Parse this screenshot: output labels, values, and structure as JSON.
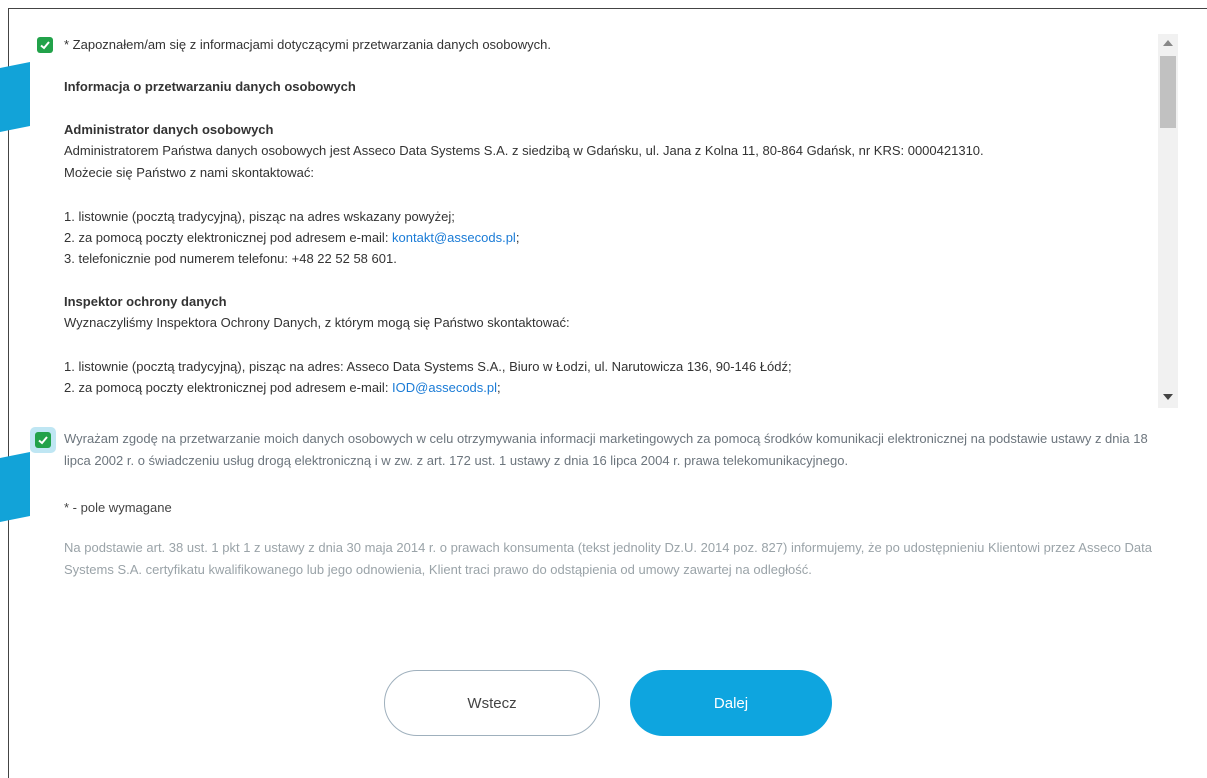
{
  "consent1": {
    "label": "* Zapoznałem/am się z informacjami dotyczącymi przetwarzania danych osobowych.",
    "checked": true
  },
  "info": {
    "heading": "Informacja o przetwarzaniu danych osobowych",
    "admin_heading": "Administrator danych osobowych",
    "admin_text": "Administratorem Państwa danych osobowych jest Asseco Data Systems S.A. z siedzibą w Gdańsku, ul. Jana z Kolna 11, 80-864 Gdańsk, nr KRS: 0000421310.",
    "admin_contact": "Możecie się Państwo z nami skontaktować:",
    "admin_list": [
      "1. listownie (pocztą tradycyjną), pisząc na adres wskazany powyżej;",
      "2. za pomocą poczty elektronicznej pod adresem e-mail: ",
      "3. telefonicznie pod numerem telefonu: +48 22 52 58 601."
    ],
    "admin_email": "kontakt@assecods.pl",
    "admin_email_suffix": ";",
    "iod_heading": "Inspektor ochrony danych",
    "iod_text": "Wyznaczyliśmy Inspektora Ochrony Danych, z którym mogą się Państwo skontaktować:",
    "iod_list": [
      "1. listownie (pocztą tradycyjną), pisząc na adres: Asseco Data Systems S.A., Biuro w Łodzi, ul. Narutowicza 136, 90-146 Łódź;",
      "2. za pomocą poczty elektronicznej pod adresem e-mail: "
    ],
    "iod_email": "IOD@assecods.pl",
    "iod_email_suffix": ";"
  },
  "consent2": {
    "label": "Wyrażam zgodę na przetwarzanie moich danych osobowych w celu otrzymywania informacji marketingowych za pomocą środków komunikacji elektronicznej na podstawie ustawy z dnia 18 lipca 2002 r. o świadczeniu usług drogą elektroniczną i w zw. z art. 172 ust. 1 ustawy z dnia 16 lipca 2004 r. prawa telekomunikacyjnego.",
    "checked": true
  },
  "required_note": "* - pole wymagane",
  "notice": "Na podstawie art. 38 ust. 1 pkt 1 z ustawy z dnia 30 maja 2014 r. o prawach konsumenta (tekst jednolity Dz.U. 2014 poz. 827) informujemy, że po udostępnieniu Klientowi przez Asseco Data Systems S.A. certyfikatu kwalifikowanego lub jego odnowienia, Klient traci prawo do odstąpienia od umowy zawartej na odległość.",
  "buttons": {
    "back": "Wstecz",
    "next": "Dalej"
  },
  "colors": {
    "accent": "#0ea5df",
    "checkbox": "#22a24a",
    "link": "#1a7bd6"
  }
}
